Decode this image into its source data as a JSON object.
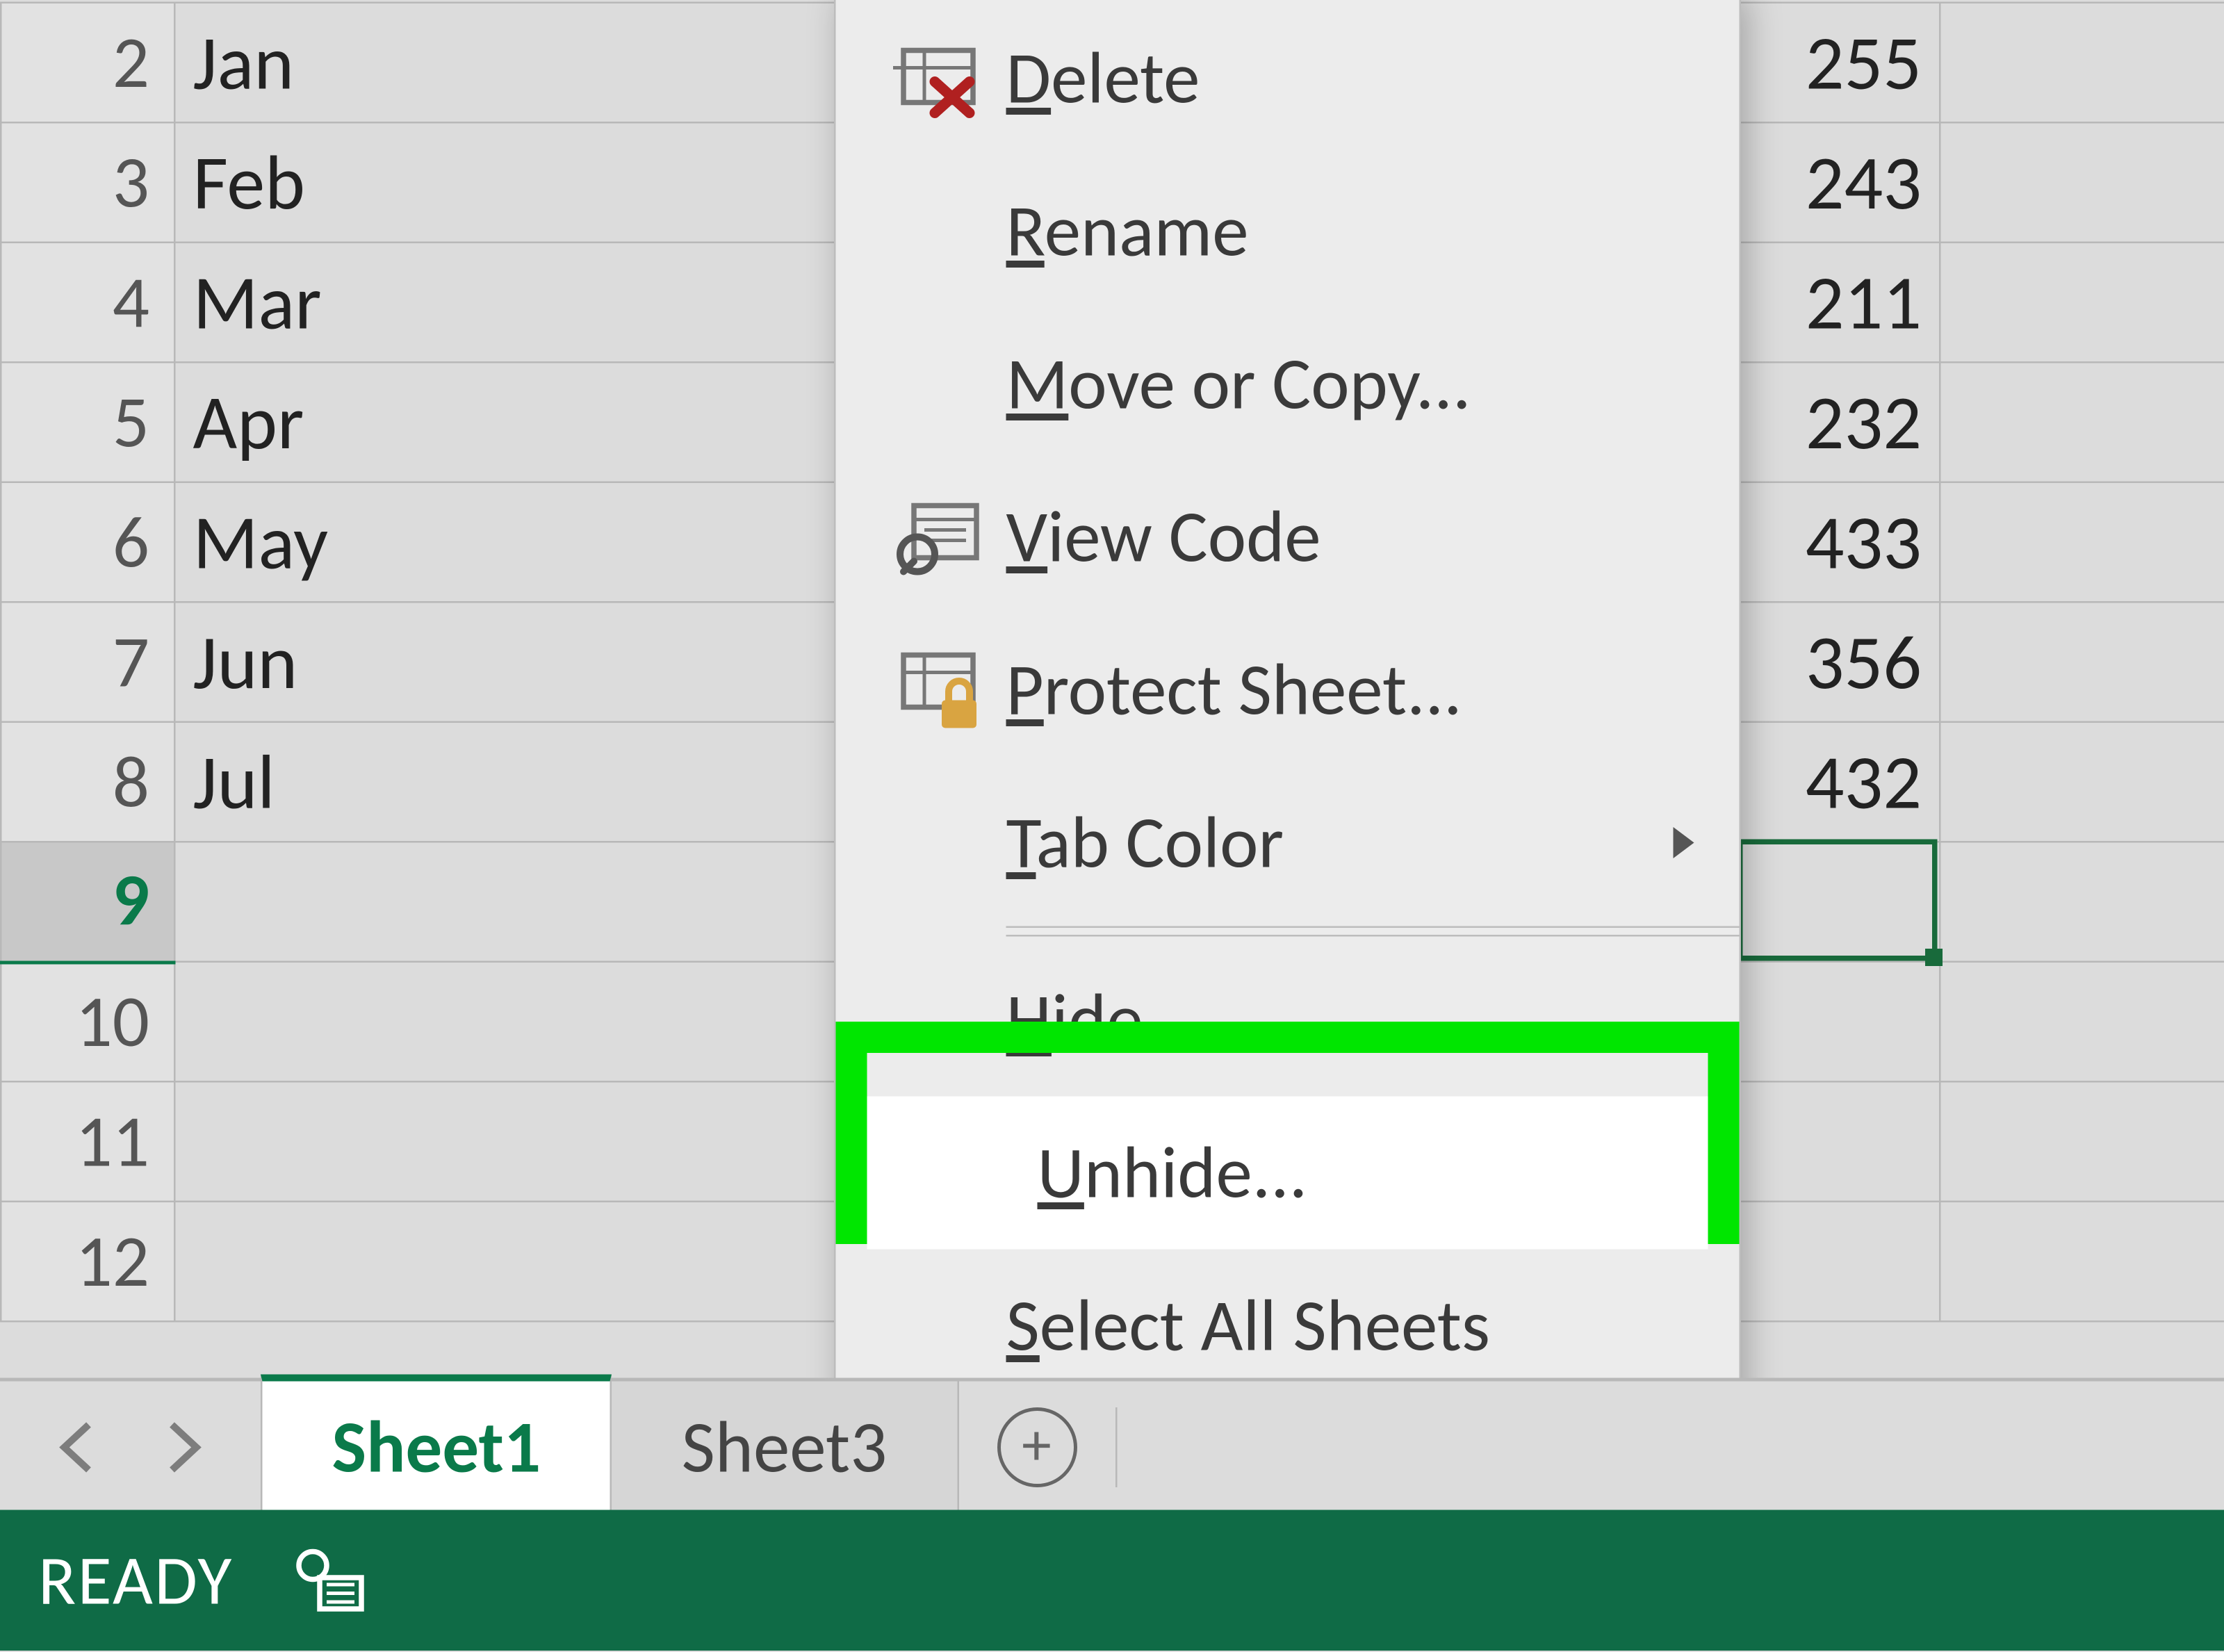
{
  "grid": {
    "rows": [
      {
        "num": "2",
        "a": "Jan",
        "c": "255"
      },
      {
        "num": "3",
        "a": "Feb",
        "c": "243"
      },
      {
        "num": "4",
        "a": "Mar",
        "c": "211"
      },
      {
        "num": "5",
        "a": "Apr",
        "c": "232"
      },
      {
        "num": "6",
        "a": "May",
        "c": "433"
      },
      {
        "num": "7",
        "a": "Jun",
        "c": "356"
      },
      {
        "num": "8",
        "a": "Jul",
        "c": "432"
      },
      {
        "num": "9",
        "a": "",
        "c": "",
        "selected": true
      },
      {
        "num": "10",
        "a": "",
        "c": ""
      },
      {
        "num": "11",
        "a": "",
        "c": ""
      },
      {
        "num": "12",
        "a": "",
        "c": ""
      }
    ]
  },
  "context_menu": {
    "items": [
      {
        "key": "delete",
        "label_pre": "",
        "label_u": "D",
        "label_post": "elete",
        "icon": "delete-icon"
      },
      {
        "key": "rename",
        "label_pre": "",
        "label_u": "R",
        "label_post": "ename",
        "icon": ""
      },
      {
        "key": "move",
        "label_pre": "",
        "label_u": "M",
        "label_post": "ove or Copy...",
        "icon": ""
      },
      {
        "key": "viewcode",
        "label_pre": "",
        "label_u": "V",
        "label_post": "iew Code",
        "icon": "view-code-icon"
      },
      {
        "key": "protect",
        "label_pre": "",
        "label_u": "P",
        "label_post": "rotect Sheet...",
        "icon": "protect-icon"
      },
      {
        "key": "tabcolor",
        "label_pre": "",
        "label_u": "T",
        "label_post": "ab Color",
        "icon": "",
        "submenu": true
      },
      {
        "key": "hide",
        "label_pre": "",
        "label_u": "H",
        "label_post": "ide",
        "icon": ""
      },
      {
        "key": "unhide",
        "label_pre": "",
        "label_u": "U",
        "label_post": "nhide...",
        "icon": "",
        "highlighted": true
      },
      {
        "key": "selectall",
        "label_pre": "",
        "label_u": "S",
        "label_post": "elect All Sheets",
        "icon": ""
      }
    ]
  },
  "tabs": {
    "items": [
      {
        "name": "Sheet1",
        "active": true
      },
      {
        "name": "Sheet3",
        "active": false
      }
    ]
  },
  "statusbar": {
    "text": "READY"
  }
}
